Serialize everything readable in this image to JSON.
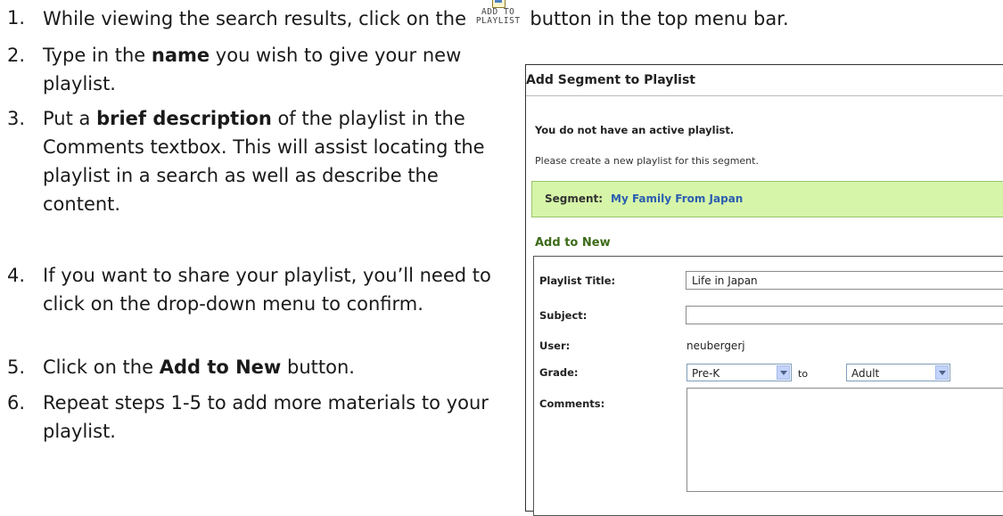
{
  "instructions": {
    "step1": {
      "num": "1.",
      "before": "While viewing the search results, click on the",
      "icon_caption": "ADD TO\nPLAYLIST",
      "after": "button in the top menu bar."
    },
    "step2": {
      "num": "2.",
      "pre": "Type in the ",
      "bold": "name",
      "post": " you wish to give your new playlist."
    },
    "step3": {
      "num": "3.",
      "pre": "Put a ",
      "bold": "brief description",
      "post": " of the playlist in the Comments textbox.  This will assist locating the playlist in a search as well as describe the content."
    },
    "step4": {
      "num": "4.",
      "text": "If you want to share your playlist, you’ll need to click on the drop-down menu to confirm."
    },
    "step5": {
      "num": "5.",
      "pre": "Click on the ",
      "bold": "Add to New",
      "post": " button."
    },
    "step6": {
      "num": "6.",
      "text": "Repeat steps 1-5 to add more materials to your playlist."
    }
  },
  "dialog": {
    "title": "Add Segment to Playlist",
    "no_active": "You do not have an active playlist.",
    "create_prompt": "Please create a new playlist for this segment.",
    "segment_label": "Segment:",
    "segment_value": "My Family From Japan",
    "add_to_new_heading": "Add to New",
    "form": {
      "playlist_title_label": "Playlist Title:",
      "playlist_title_value": "Life in Japan",
      "subject_label": "Subject:",
      "subject_value": "",
      "user_label": "User:",
      "user_value": "neubergerj",
      "grade_label": "Grade:",
      "grade_from": "Pre-K",
      "grade_to_word": "to",
      "grade_to": "Adult",
      "comments_label": "Comments:"
    }
  }
}
